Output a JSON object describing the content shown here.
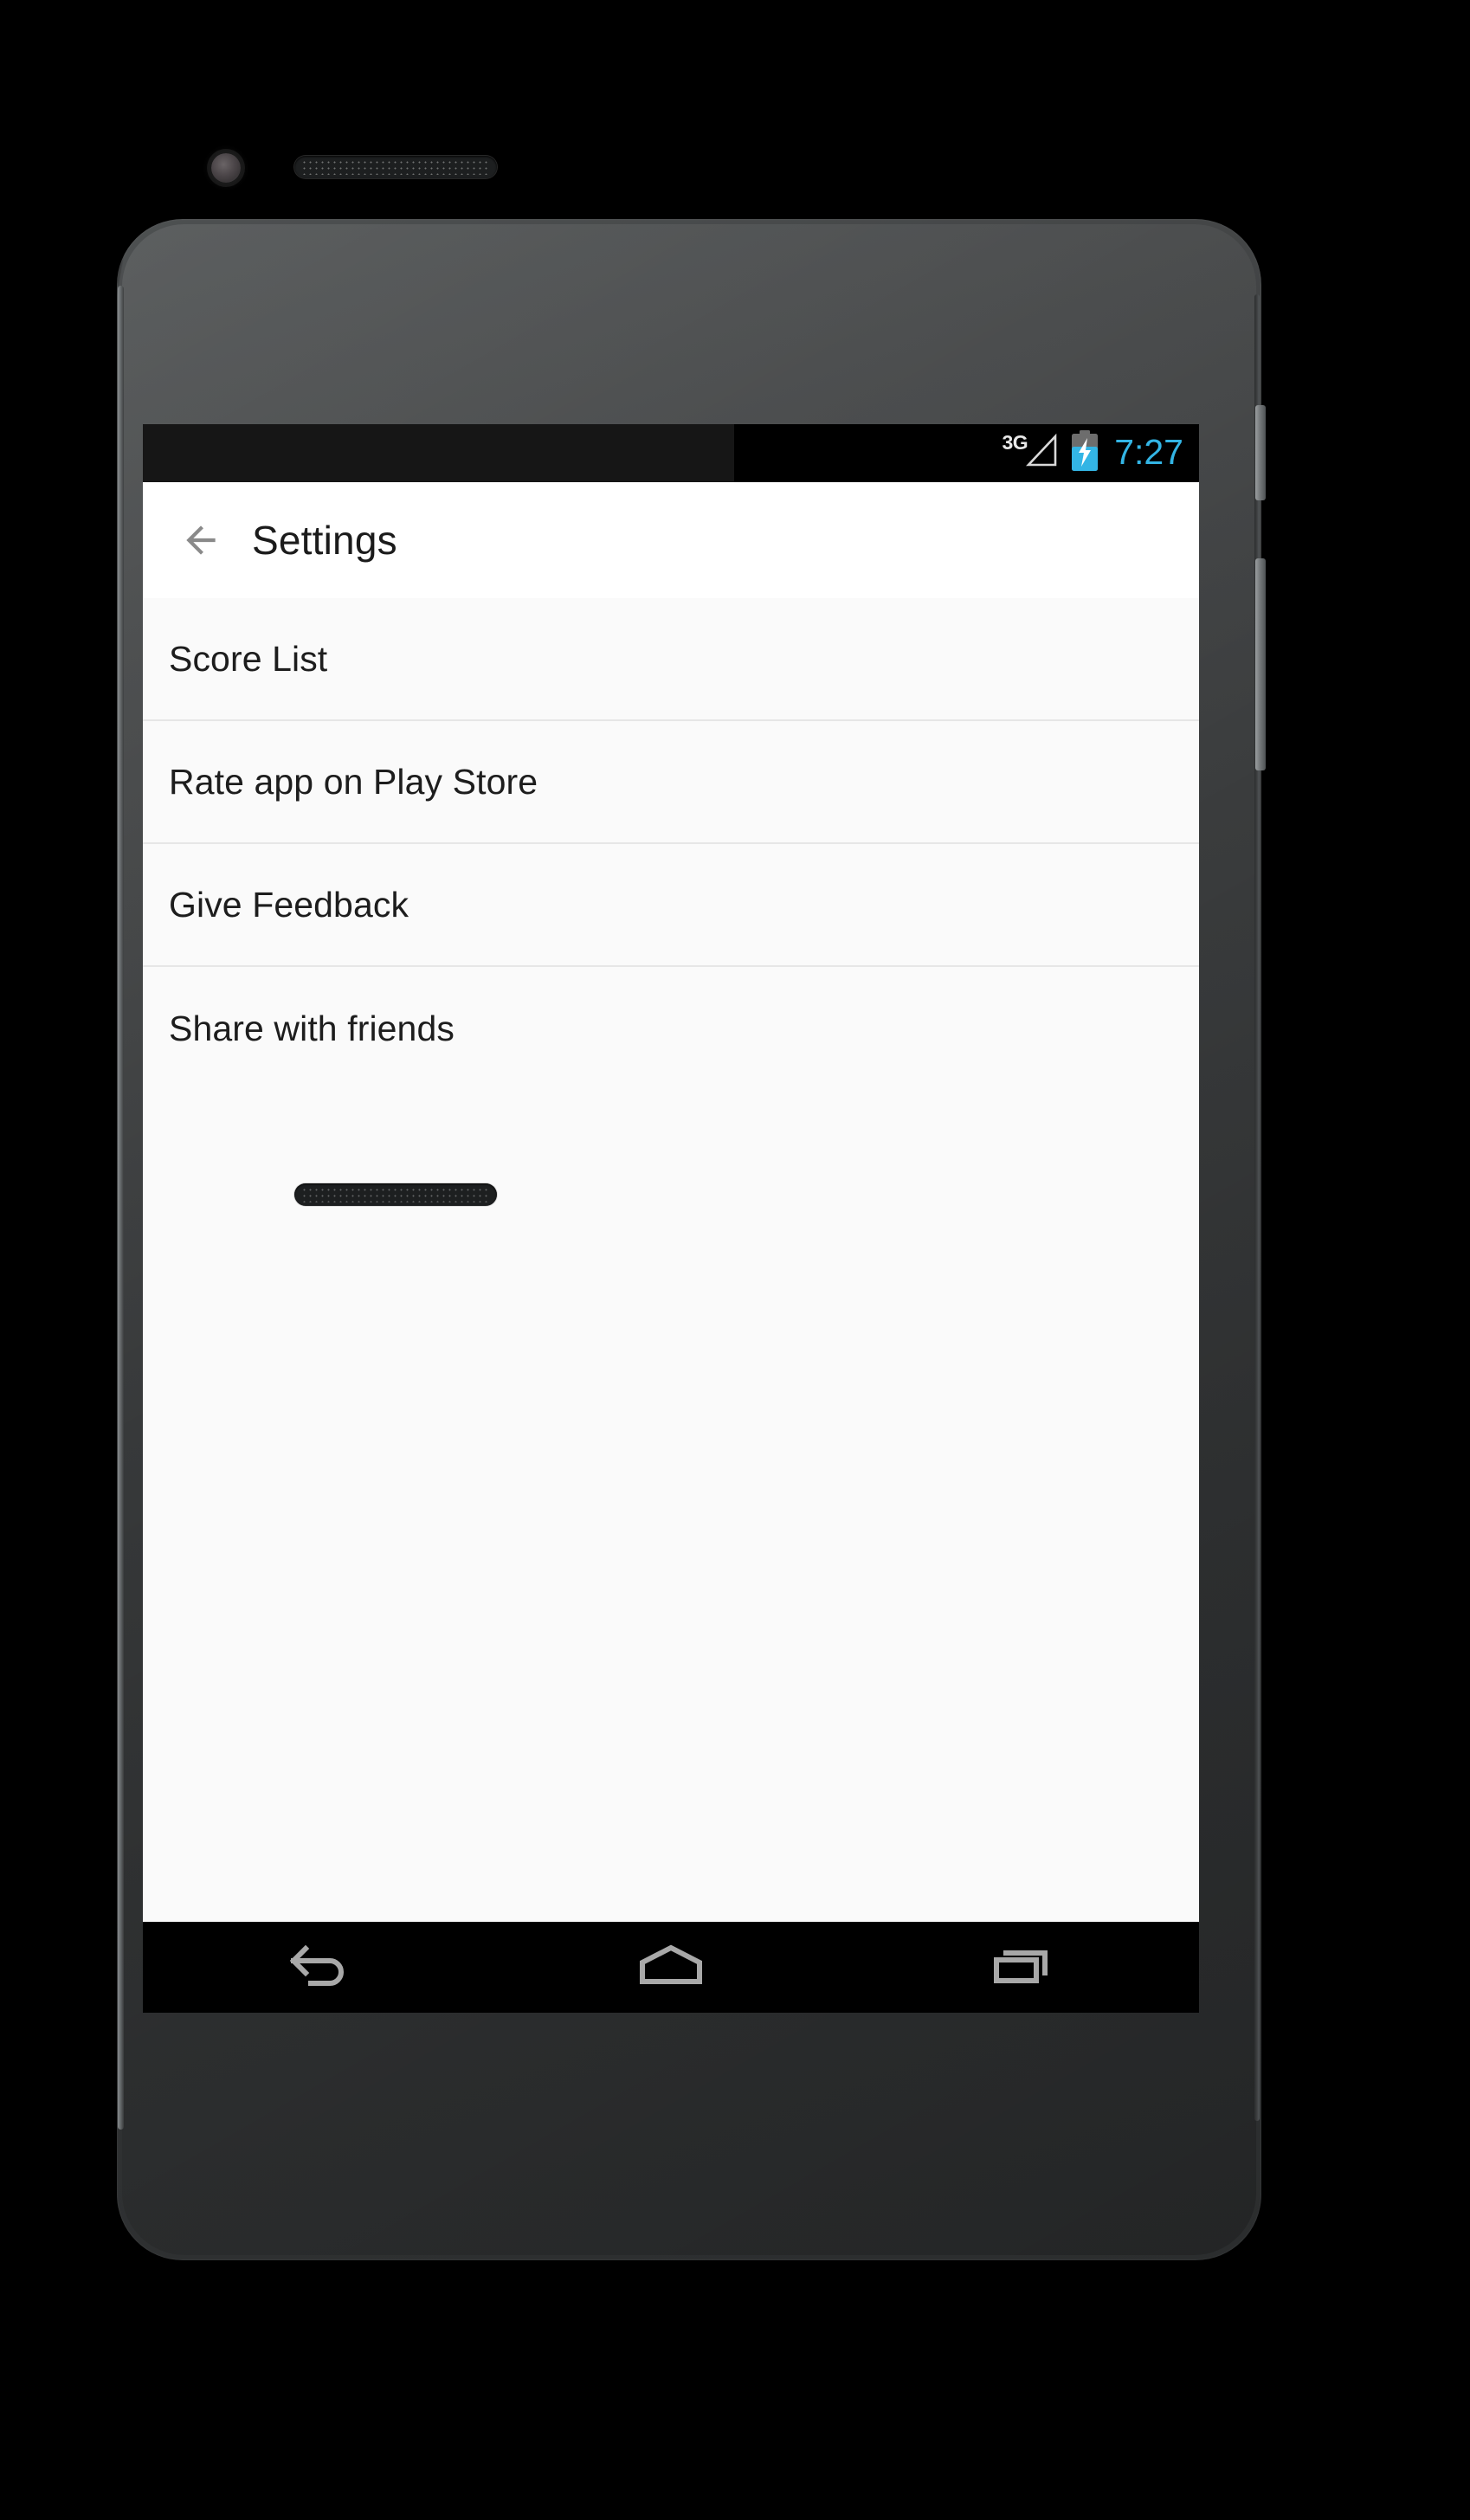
{
  "device": {
    "hardware": {
      "front_camera": "front-camera",
      "earpiece": "earpiece-speaker",
      "bottom_speaker": "bottom-speaker",
      "power_button": "power-button",
      "volume_button": "volume-button"
    }
  },
  "status_bar": {
    "network_label": "3G",
    "signal_icon": "signal-triangle-empty-icon",
    "battery_icon": "battery-charging-icon",
    "battery_accent": "#33b5e5",
    "time": "7:27",
    "time_color": "#33b5e5",
    "background": "#000000"
  },
  "app_bar": {
    "back_icon": "arrow-left-icon",
    "title": "Settings",
    "background": "#ffffff",
    "title_color": "#1b1b1b",
    "icon_color": "#8a8a8a"
  },
  "settings_list": {
    "background": "#fafafa",
    "divider_color": "#e6e6e6",
    "items": [
      {
        "label": "Score List"
      },
      {
        "label": "Rate app on Play Store"
      },
      {
        "label": "Give Feedback"
      },
      {
        "label": "Share with friends"
      }
    ]
  },
  "nav_bar": {
    "background": "#000000",
    "icon_color": "#a8a8a8",
    "buttons": [
      {
        "name": "back",
        "icon": "nav-back-icon"
      },
      {
        "name": "home",
        "icon": "nav-home-icon"
      },
      {
        "name": "recents",
        "icon": "nav-recents-icon"
      }
    ]
  }
}
